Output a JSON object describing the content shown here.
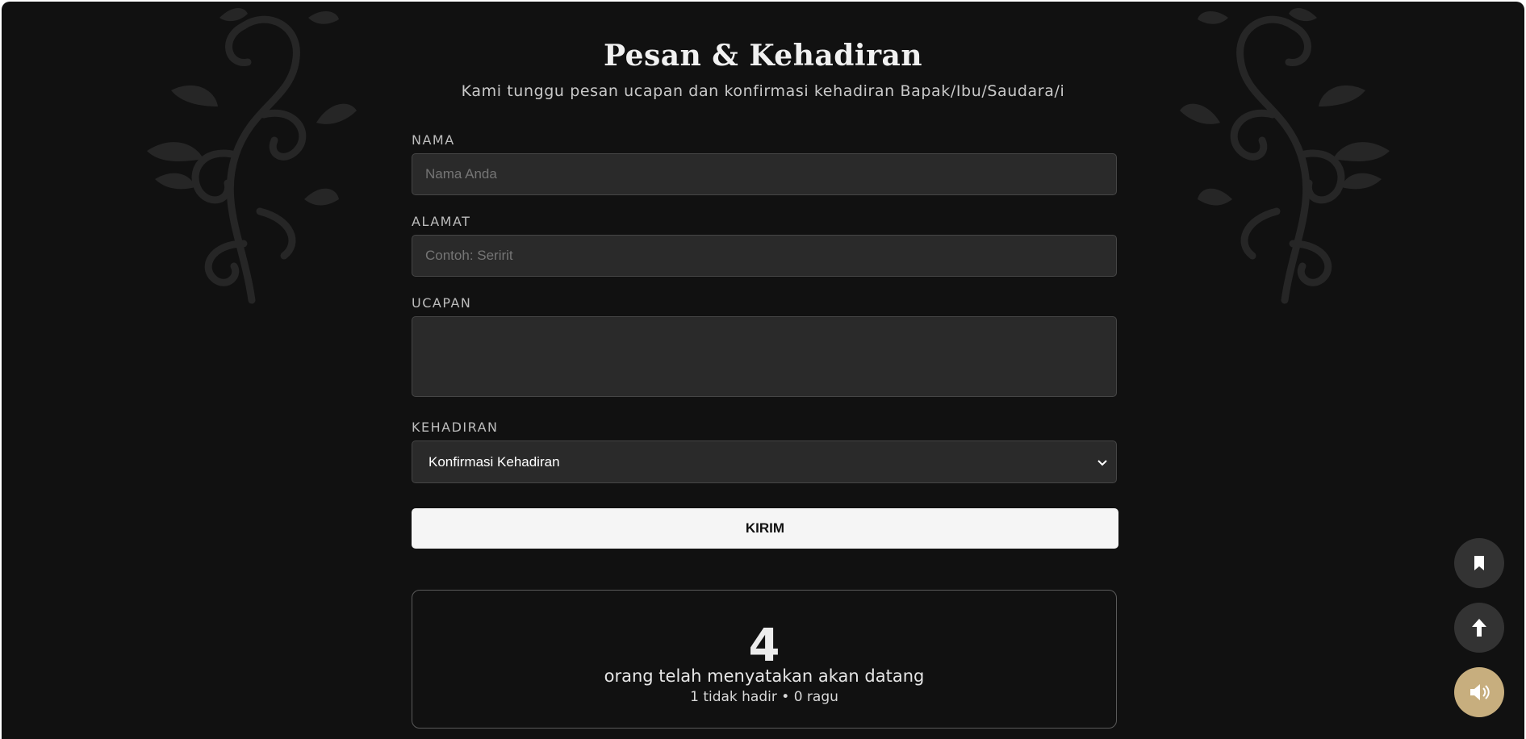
{
  "section": {
    "title": "Pesan & Kehadiran",
    "subtitle": "Kami tunggu pesan ucapan dan konfirmasi kehadiran Bapak/Ibu/Saudara/i"
  },
  "form": {
    "name": {
      "label": "NAMA",
      "placeholder": "Nama Anda",
      "value": ""
    },
    "address": {
      "label": "ALAMAT",
      "placeholder": "Contoh: Seririt",
      "value": ""
    },
    "message": {
      "label": "UCAPAN",
      "placeholder": "",
      "value": ""
    },
    "attendance": {
      "label": "KEHADIRAN",
      "selected": "Konfirmasi Kehadiran"
    },
    "submit_label": "KIRIM"
  },
  "stats": {
    "attending_count": "4",
    "attending_text": "orang telah menyatakan akan datang",
    "summary": "1 tidak hadir • 0 ragu"
  },
  "floating_buttons": [
    {
      "icon": "bookmark-icon"
    },
    {
      "icon": "arrow-up-icon"
    },
    {
      "icon": "speaker-icon"
    }
  ],
  "colors": {
    "background": "#111111",
    "field_background": "#2a2a2a",
    "accent_gold": "#c7ae7e",
    "button_light": "#f5f5f5"
  }
}
